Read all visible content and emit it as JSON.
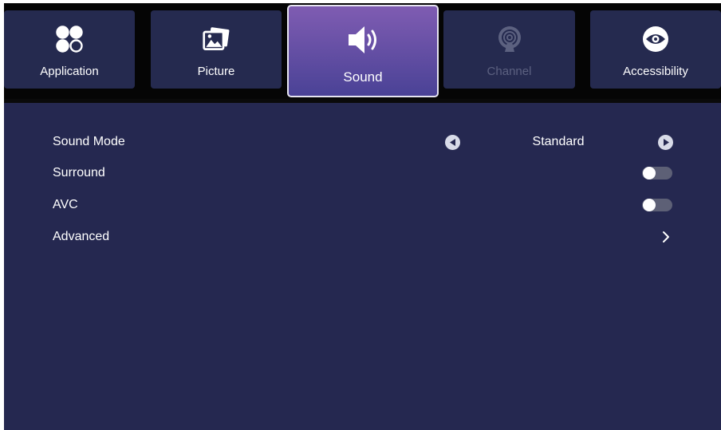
{
  "tabs": [
    {
      "label": "Application",
      "icon": "apps-icon",
      "state": "normal"
    },
    {
      "label": "Picture",
      "icon": "picture-icon",
      "state": "normal"
    },
    {
      "label": "Sound",
      "icon": "speaker-icon",
      "state": "active"
    },
    {
      "label": "Channel",
      "icon": "channel-antenna-icon",
      "state": "disabled"
    },
    {
      "label": "Accessibility",
      "icon": "eye-icon",
      "state": "normal"
    }
  ],
  "settings": {
    "sound_mode": {
      "label": "Sound Mode",
      "value": "Standard"
    },
    "surround": {
      "label": "Surround",
      "on": false
    },
    "avc": {
      "label": "AVC",
      "on": false
    },
    "advanced": {
      "label": "Advanced"
    }
  },
  "colors": {
    "panel_bg": "#252850",
    "tab_bg": "#252a4f",
    "active_tab_top": "#7f5cb2",
    "active_tab_bottom": "#4a4296",
    "disabled_text": "#5c6180"
  }
}
